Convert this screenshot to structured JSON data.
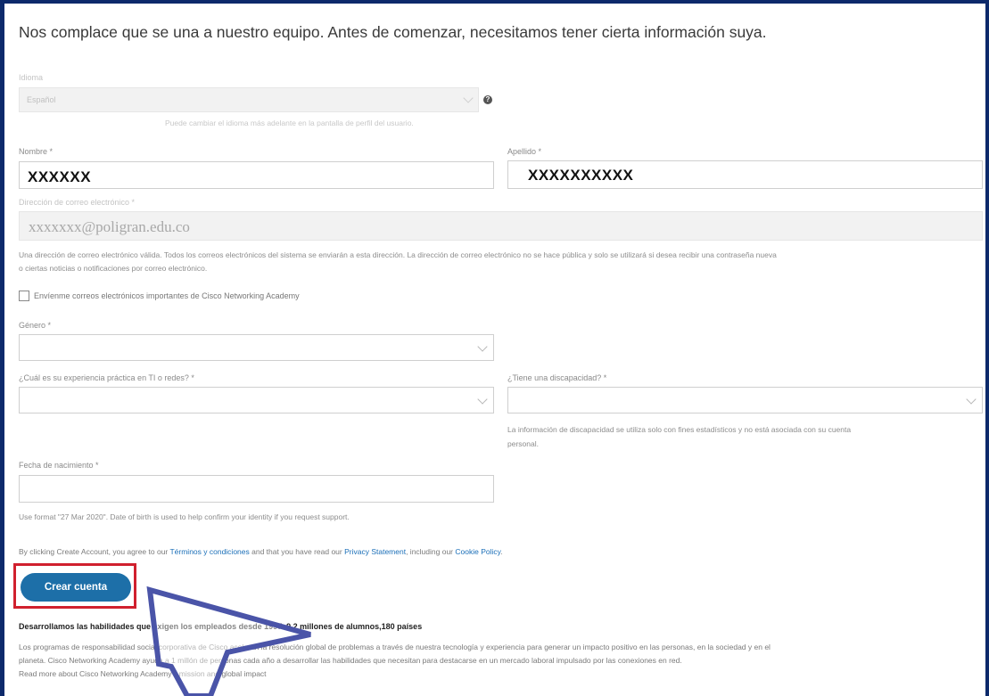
{
  "intro_text": "Nos complace que se una a nuestro equipo. Antes de comenzar, necesitamos tener cierta información suya.",
  "language": {
    "label": "Idioma",
    "value": "Español",
    "help": "Puede cambiar el idioma más adelante en la pantalla de perfil del usuario."
  },
  "first_name": {
    "label": "Nombre *",
    "value": "XXXXXX"
  },
  "last_name": {
    "label": "Apellido *",
    "value": "XXXXXXXXXX"
  },
  "email": {
    "label": "Dirección de correo electrónico *",
    "value": "xxxxxxx@poligran.edu.co",
    "help_line1": "Una dirección de correo electrónico válida. Todos los correos electrónicos del sistema se enviarán a esta dirección. La dirección de correo electrónico no se hace pública y solo se utilizará si desea recibir una contraseña nueva",
    "help_line2": "o ciertas noticias o notificaciones por correo electrónico."
  },
  "newsletter_checkbox": {
    "label": "Envíenme correos electrónicos importantes de Cisco Networking Academy",
    "checked": false
  },
  "gender": {
    "label": "Género *",
    "value": ""
  },
  "experience": {
    "label": "¿Cuál es su experiencia práctica en TI o redes? *",
    "value": ""
  },
  "disability": {
    "label": "¿Tiene una discapacidad? *",
    "value": "",
    "help_line1": "La información de discapacidad se utiliza solo con fines estadísticos y no está asociada con su cuenta",
    "help_line2": "personal."
  },
  "birth_date": {
    "label": "Fecha de nacimiento *",
    "value": "",
    "help": "Use format \"27 Mar 2020\". Date of birth is used to help confirm your identity if you request support."
  },
  "terms": {
    "prefix": "By clicking Create Account, you agree to our ",
    "terms_link": "Términos y condiciones",
    "middle": " and that you have read our ",
    "privacy_link": "Privacy Statement",
    "middle2": ", including our ",
    "cookie_link": "Cookie Policy",
    "suffix": "."
  },
  "create_button": "Crear cuenta",
  "tagline": "Desarrollamos las habilidades que exigen los empleados desde 1997. 9,2 millones de alumnos,180 países",
  "footer": {
    "line1": "Los programas de responsabilidad social corporativa de Cisco aceleran la resolución global de problemas a través de nuestra tecnología y experiencia para generar un impacto positivo en las personas, en la sociedad y en el",
    "line2": "planeta. Cisco Networking Academy ayuda a 1 millón de personas cada año a desarrollar las habilidades que necesitan para destacarse en un mercado laboral impulsado por las conexiones en red.",
    "link": "Read more about Cisco Networking Academy's mission and global impact"
  },
  "colors": {
    "accent": "#1d6fa8",
    "highlight": "#d0202e",
    "frame": "#0d2a6b",
    "arrow": "#4a54a8"
  },
  "icons": [
    "help-icon",
    "chevron-down-icon",
    "arrow-annotation"
  ]
}
